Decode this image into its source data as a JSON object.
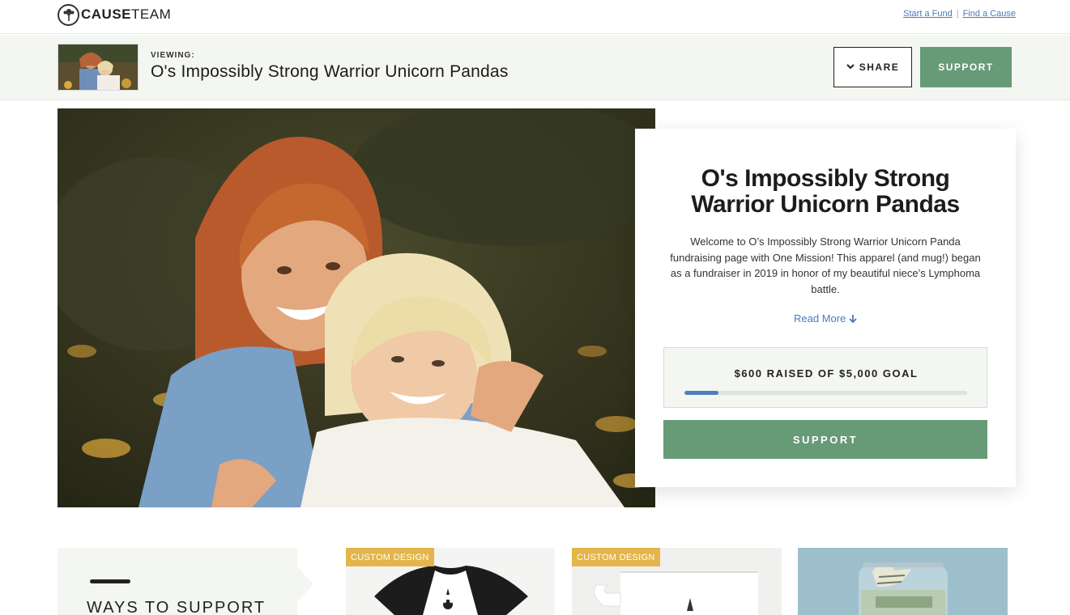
{
  "brand": {
    "name_bold": "CAUSE",
    "name_light": "TEAM"
  },
  "top_links": {
    "start_fund": "Start a Fund",
    "separator": "|",
    "find_cause": "Find a Cause"
  },
  "viewing_bar": {
    "label": "VIEWING:",
    "title": "O's Impossibly Strong Warrior Unicorn Pandas",
    "share_label": "SHARE",
    "support_label": "SUPPORT"
  },
  "campaign": {
    "title": "O's Impossibly Strong Warrior Unicorn Pandas",
    "description": "Welcome to O’s Impossibly Strong Warrior Unicorn Panda fundraising page with One Mission! This apparel (and mug!) began as a fundraiser in 2019 in honor of my beautiful niece’s Lymphoma battle.",
    "read_more": "Read More",
    "goal_text": "$600 RAISED OF $5,000 GOAL",
    "raised": 600,
    "goal": 5000,
    "progress_fraction": 0.12,
    "support_label": "SUPPORT"
  },
  "ways": {
    "title": "WAYS TO SUPPORT"
  },
  "tiles": [
    {
      "badge": "CUSTOM DESIGN",
      "icon": "raglan-shirt-image"
    },
    {
      "badge": "CUSTOM DESIGN",
      "icon": "mug-image"
    },
    {
      "badge": "",
      "icon": "money-jar-image"
    }
  ],
  "colors": {
    "accent_green": "#679a76",
    "link_blue": "#4a7bbf",
    "progress_blue": "#4d7fbd",
    "badge_gold": "#e3b54a",
    "band_bg": "#f3f6f1"
  }
}
